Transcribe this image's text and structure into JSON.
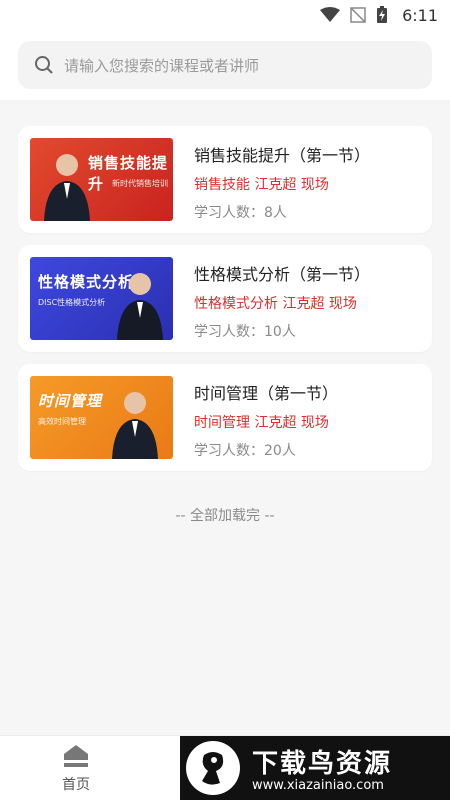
{
  "status_bar": {
    "time": "6:11"
  },
  "search": {
    "placeholder": "请输入您搜索的课程或者讲师"
  },
  "courses": [
    {
      "thumb_title": "销售技能提升",
      "thumb_sub": "新时代销售培训",
      "title": "销售技能提升（第一节）",
      "tags": "销售技能 江克超 现场",
      "learners": "学习人数：8人",
      "bg": "#e0402c"
    },
    {
      "thumb_title": "性格模式分析",
      "thumb_sub": "DISC性格模式分析",
      "title": "性格模式分析（第一节）",
      "tags": "性格模式分析 江克超 现场",
      "learners": "学习人数：10人",
      "bg": "#3a3fd0"
    },
    {
      "thumb_title": "时间管理",
      "thumb_sub": "高效时间管理",
      "title": "时间管理（第一节）",
      "tags": "时间管理 江克超 现场",
      "learners": "学习人数：20人",
      "bg": "#f08a20"
    }
  ],
  "footer_message": "-- 全部加载完 --",
  "tabbar": {
    "home_label": "首页"
  },
  "watermark": {
    "text": "下载鸟资源",
    "url": "www.xiazainiao.com"
  },
  "colors": {
    "accent_red": "#d8312f"
  }
}
